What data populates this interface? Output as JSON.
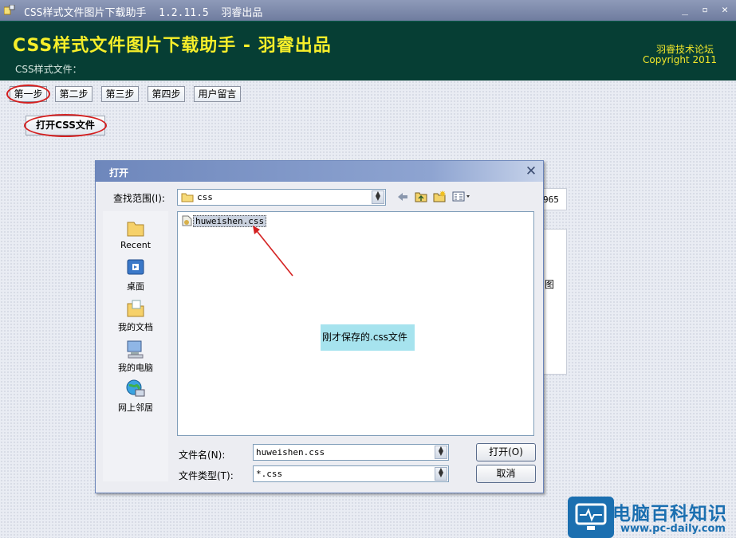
{
  "window": {
    "title": "CSS样式文件图片下载助手  1.2.11.5  羽睿出品",
    "minimize": "_",
    "maximize": "▫",
    "close": "✕"
  },
  "header": {
    "title": "CSS样式文件图片下载助手 - 羽睿出品",
    "subtitle": "CSS样式文件：",
    "forum": "羽睿技术论坛",
    "copyright": "Copyright 2011"
  },
  "steps": [
    "第一步",
    "第二步",
    "第三步",
    "第四步",
    "用户留言"
  ],
  "open_css_label": "打开CSS文件",
  "background_fragments": {
    "field_tail": "965",
    "panel_tail": "图"
  },
  "dialog": {
    "title": "打开",
    "lookin_label": "查找范围(I):",
    "lookin_value": "css",
    "places": [
      "Recent",
      "桌面",
      "我的文档",
      "我的电脑",
      "网上邻居"
    ],
    "files": [
      {
        "name": "huweishen.css",
        "selected": true
      }
    ],
    "callout": "刚才保存的.css文件",
    "filename_label": "文件名(N):",
    "filename_value": "huweishen.css",
    "filetype_label": "文件类型(T):",
    "filetype_value": "*.css",
    "open_button": "打开(O)",
    "cancel_button": "取消"
  },
  "watermark": {
    "name": "电脑百科知识",
    "url": "www.pc-daily.com"
  },
  "colors": {
    "header_bg": "#063e34",
    "header_title": "#f6ee2a",
    "highlight_ring": "#d42020",
    "callout_bg": "#a6e3ee",
    "watermark_blue": "#1b6fb0"
  }
}
